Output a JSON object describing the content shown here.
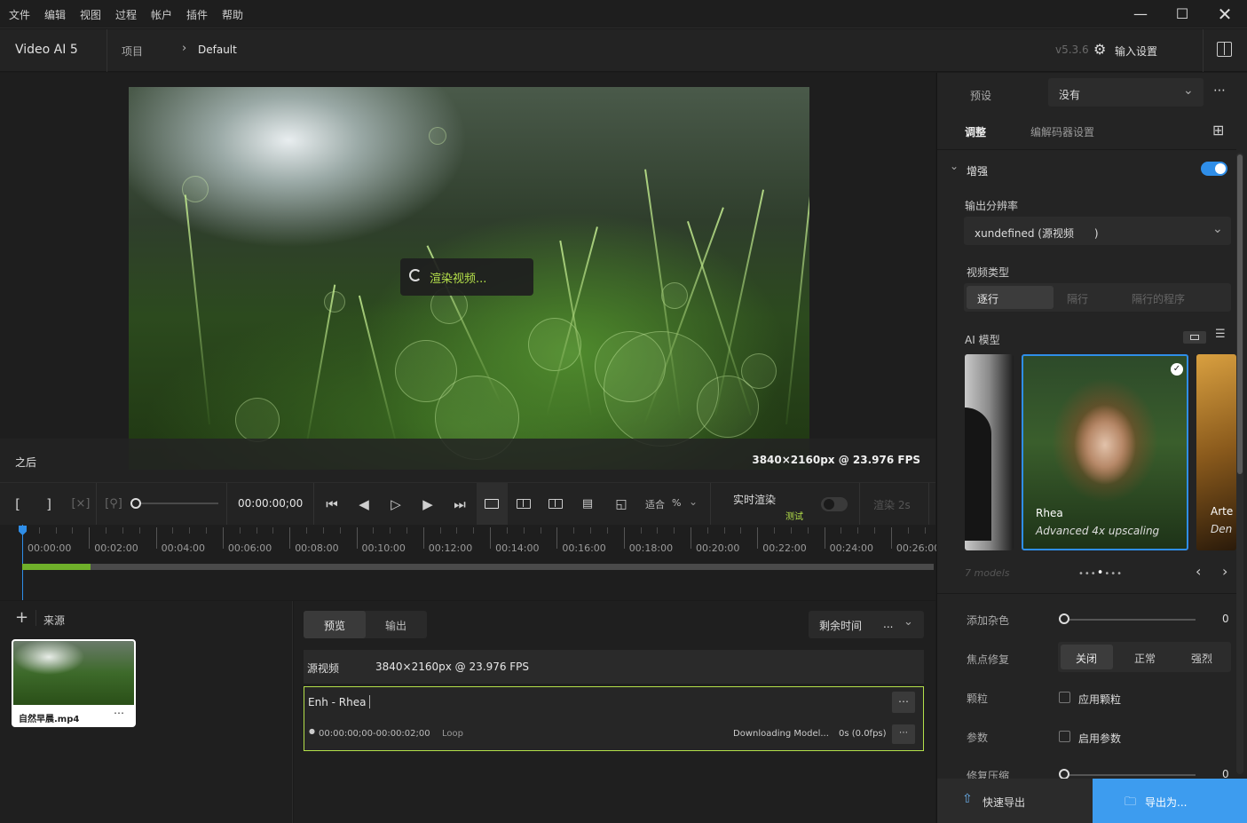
{
  "menu": {
    "items": [
      "文件",
      "编辑",
      "视图",
      "过程",
      "帐户",
      "插件",
      "帮助"
    ]
  },
  "window": {
    "minimize_icon": "minimize-icon",
    "maximize_icon": "maximize-icon",
    "close_icon": "close-icon"
  },
  "header": {
    "app_title": "Video AI  5",
    "breadcrumb_project": "项目",
    "breadcrumb_current": "Default",
    "version": "v5.3.6",
    "input_settings": "输入设置"
  },
  "preview": {
    "render_status": "渲染视频...",
    "after_label": "之后",
    "source_info": "3840×2160px @ 23.976 FPS"
  },
  "toolbar": {
    "timecode": "00:00:00;00",
    "fit_label": "适合",
    "zoom_unit": "%",
    "realtime_render": "实时渲染",
    "realtime_tag": "测试",
    "render_time": "渲染 2s"
  },
  "timeline": {
    "ticks": [
      "00:00:00",
      "00:02:00",
      "00:04:00",
      "00:06:00",
      "00:08:00",
      "00:10:00",
      "00:12:00",
      "00:14:00",
      "00:16:00",
      "00:18:00",
      "00:20:00",
      "00:22:00",
      "00:24:00",
      "00:26:00"
    ],
    "progress": 0.075
  },
  "sources": {
    "title": "来源",
    "file_name": "自然早晨.mp4"
  },
  "queue": {
    "tab_preview": "预览",
    "tab_output": "输出",
    "remaining_label": "剩余时间",
    "remaining_value": "...",
    "source_label": "源视频",
    "source_value": "3840×2160px @ 23.976 FPS",
    "job_title": "Enh - Rhea",
    "job_range": "00:00:00;00-00:00:02;00",
    "job_loop": "Loop",
    "job_status": "Downloading Model...",
    "job_fps": "0s (0.0fps)"
  },
  "panel": {
    "preset_label": "预设",
    "preset_value": "没有",
    "tab_adjust": "调整",
    "tab_codec": "编解码器设置",
    "enhance_label": "增强",
    "enhance_on": true,
    "output_res_label": "输出分辨率",
    "output_res_value": "xundefined (源视频      )",
    "video_type_label": "视频类型",
    "video_types": [
      "逐行",
      "隔行",
      "隔行的程序"
    ],
    "ai_model_label": "AI 模型",
    "models_count": "7 models",
    "model_left_name": "",
    "model_selected_name": "Rhea",
    "model_selected_desc": "Advanced 4x upscaling",
    "model_right_name": "Arte",
    "model_right_desc": "Den",
    "add_noise_label": "添加杂色",
    "add_noise_value": "0",
    "focus_fix_label": "焦点修复",
    "focus_options": [
      "关闭",
      "正常",
      "强烈"
    ],
    "grain_label": "颗粒",
    "grain_check_label": "应用颗粒",
    "params_label": "参数",
    "params_check_label": "启用参数",
    "compress_label": "修复压缩",
    "compress_value": "0",
    "quick_export": "快速导出",
    "export_as": "导出为..."
  },
  "colors": {
    "accent": "#2f8ee8",
    "highlight": "#b4e04a",
    "export_bg": "#3d9cef"
  }
}
